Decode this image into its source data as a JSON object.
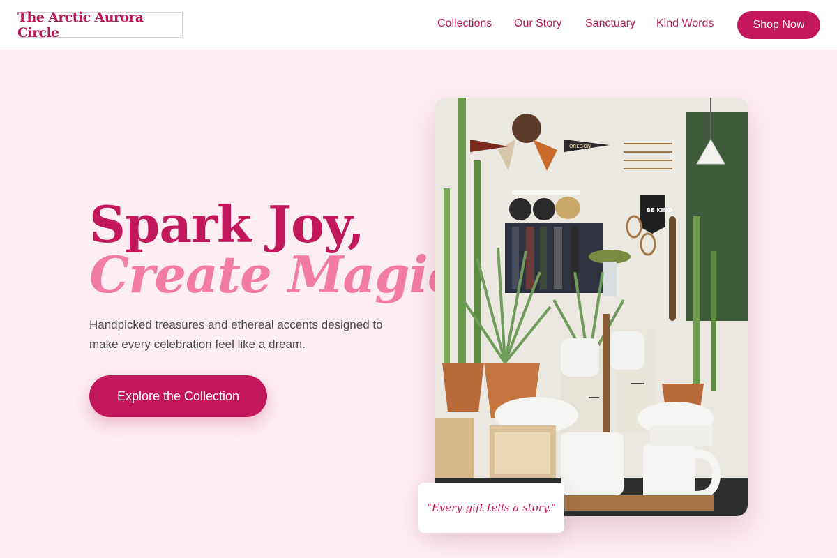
{
  "brand": {
    "name": "The Arctic Aurora Circle"
  },
  "nav": {
    "items": [
      {
        "label": "Collections"
      },
      {
        "label": "Our Story"
      },
      {
        "label": "Sanctuary"
      },
      {
        "label": "Kind Words"
      }
    ],
    "cta_label": "Shop Now"
  },
  "hero": {
    "headline_line1": "Spark Joy,",
    "headline_line2": "Create Magic.",
    "subtitle": "Handpicked treasures and ethereal accents designed to make every celebration feel like a dream.",
    "cta_label": "Explore the Collection",
    "quote": "\"Every gift tells a story.\""
  },
  "image": {
    "pennant_text": "OREGON",
    "banner_text": "BE KIND"
  },
  "colors": {
    "accent": "#c2185b",
    "accent_light": "#f27ca6",
    "background": "#fdeef3"
  }
}
